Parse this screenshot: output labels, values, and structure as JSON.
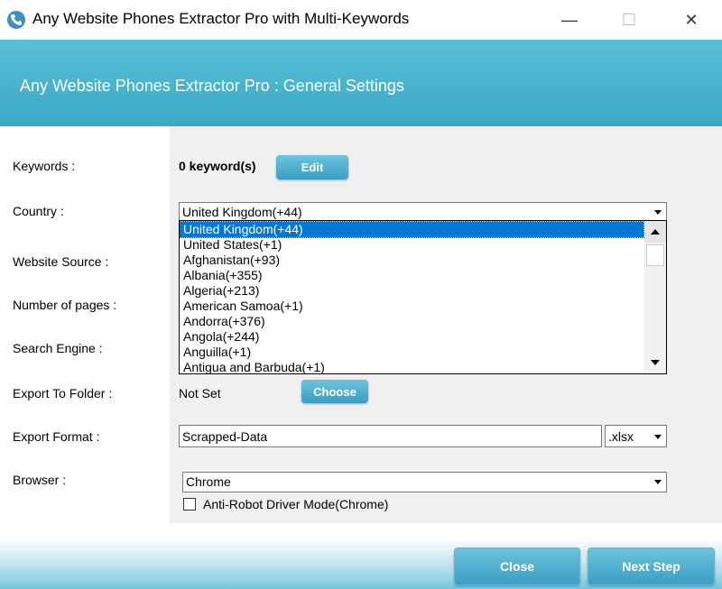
{
  "window": {
    "title": "Any Website Phones Extractor Pro with Multi-Keywords",
    "minimize_glyph": "—",
    "maximize_glyph": "☐",
    "close_glyph": "✕"
  },
  "header": {
    "title": "Any Website Phones Extractor Pro : General Settings"
  },
  "labels": {
    "keywords": "Keywords :",
    "country": "Country :",
    "website_source": "Website Source :",
    "number_of_pages": "Number of pages :",
    "search_engine": "Search Engine :",
    "export_to_folder": "Export To Folder :",
    "export_format": "Export Format :",
    "browser": "Browser :"
  },
  "keywords": {
    "count_text": "0 keyword(s)",
    "edit_label": "Edit"
  },
  "country": {
    "selected": "United Kingdom(+44)",
    "options": [
      "United Kingdom(+44)",
      "United States(+1)",
      "Afghanistan(+93)",
      "Albania(+355)",
      "Algeria(+213)",
      "American Samoa(+1)",
      "Andorra(+376)",
      "Angola(+244)",
      "Anguilla(+1)",
      "Antigua and Barbuda(+1)"
    ],
    "highlighted_index": 0
  },
  "export_folder": {
    "value": "Not Set",
    "choose_label": "Choose"
  },
  "export_format": {
    "filename": "Scrapped-Data",
    "extension": ".xlsx"
  },
  "browser": {
    "selected": "Chrome",
    "anti_robot_label": "Anti-Robot Driver Mode(Chrome)",
    "anti_robot_checked": false
  },
  "footer": {
    "close_label": "Close",
    "next_label": "Next Step"
  },
  "colors": {
    "header": "#3aa8c6",
    "selection": "#0078d7",
    "button": "#4aaed0"
  }
}
